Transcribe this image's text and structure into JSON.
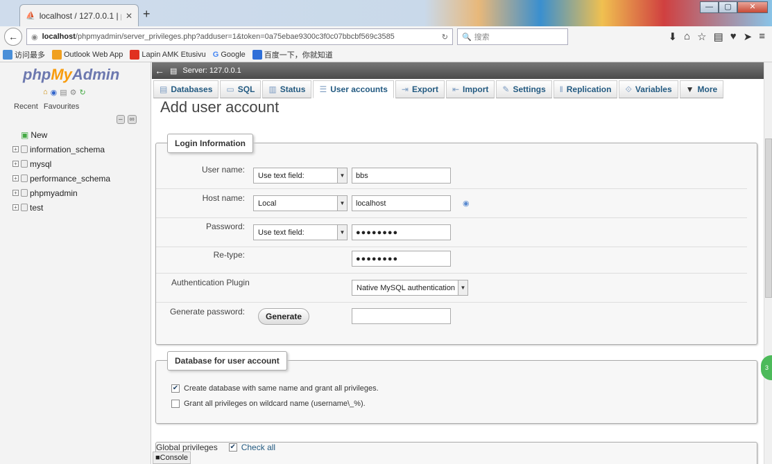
{
  "browser": {
    "tab_title": "localhost / 127.0.0.1 | php...",
    "url_host": "localhost",
    "url_path": "/phpmyadmin/server_privileges.php?adduser=1&token=0a75ebae9300c3f0c07bbcbf569c3585",
    "search_placeholder": "搜索",
    "bookmarks": [
      "访问最多",
      "Outlook Web App",
      "Lapin AMK Etusivu",
      "Google",
      "百度一下，你就知道"
    ]
  },
  "sidebar": {
    "logo_php": "php",
    "logo_my": "My",
    "logo_admin": "Admin",
    "recent": "Recent",
    "favourites": "Favourites",
    "items": [
      "New",
      "information_schema",
      "mysql",
      "performance_schema",
      "phpmyadmin",
      "test"
    ]
  },
  "server": {
    "label": "Server: 127.0.0.1"
  },
  "tabs": [
    "Databases",
    "SQL",
    "Status",
    "User accounts",
    "Export",
    "Import",
    "Settings",
    "Replication",
    "Variables",
    "More"
  ],
  "page_title": "Add user account",
  "login": {
    "legend": "Login Information",
    "user_label": "User name:",
    "user_type": "Use text field:",
    "user_value": "bbs",
    "host_label": "Host name:",
    "host_type": "Local",
    "host_value": "localhost",
    "password_label": "Password:",
    "password_type": "Use text field:",
    "password_value": "●●●●●●●●",
    "retype_label": "Re-type:",
    "retype_value": "●●●●●●●●",
    "auth_label": "Authentication Plugin",
    "auth_value": "Native MySQL authentication",
    "gen_label": "Generate password:",
    "gen_button": "Generate"
  },
  "database": {
    "legend": "Database for user account",
    "opt1": "Create database with same name and grant all privileges.",
    "opt1_checked": true,
    "opt2": "Grant all privileges on wildcard name (username\\_%).",
    "opt2_checked": false
  },
  "global": {
    "legend": "Global privileges",
    "check_all": "Check all"
  },
  "console": "Console"
}
